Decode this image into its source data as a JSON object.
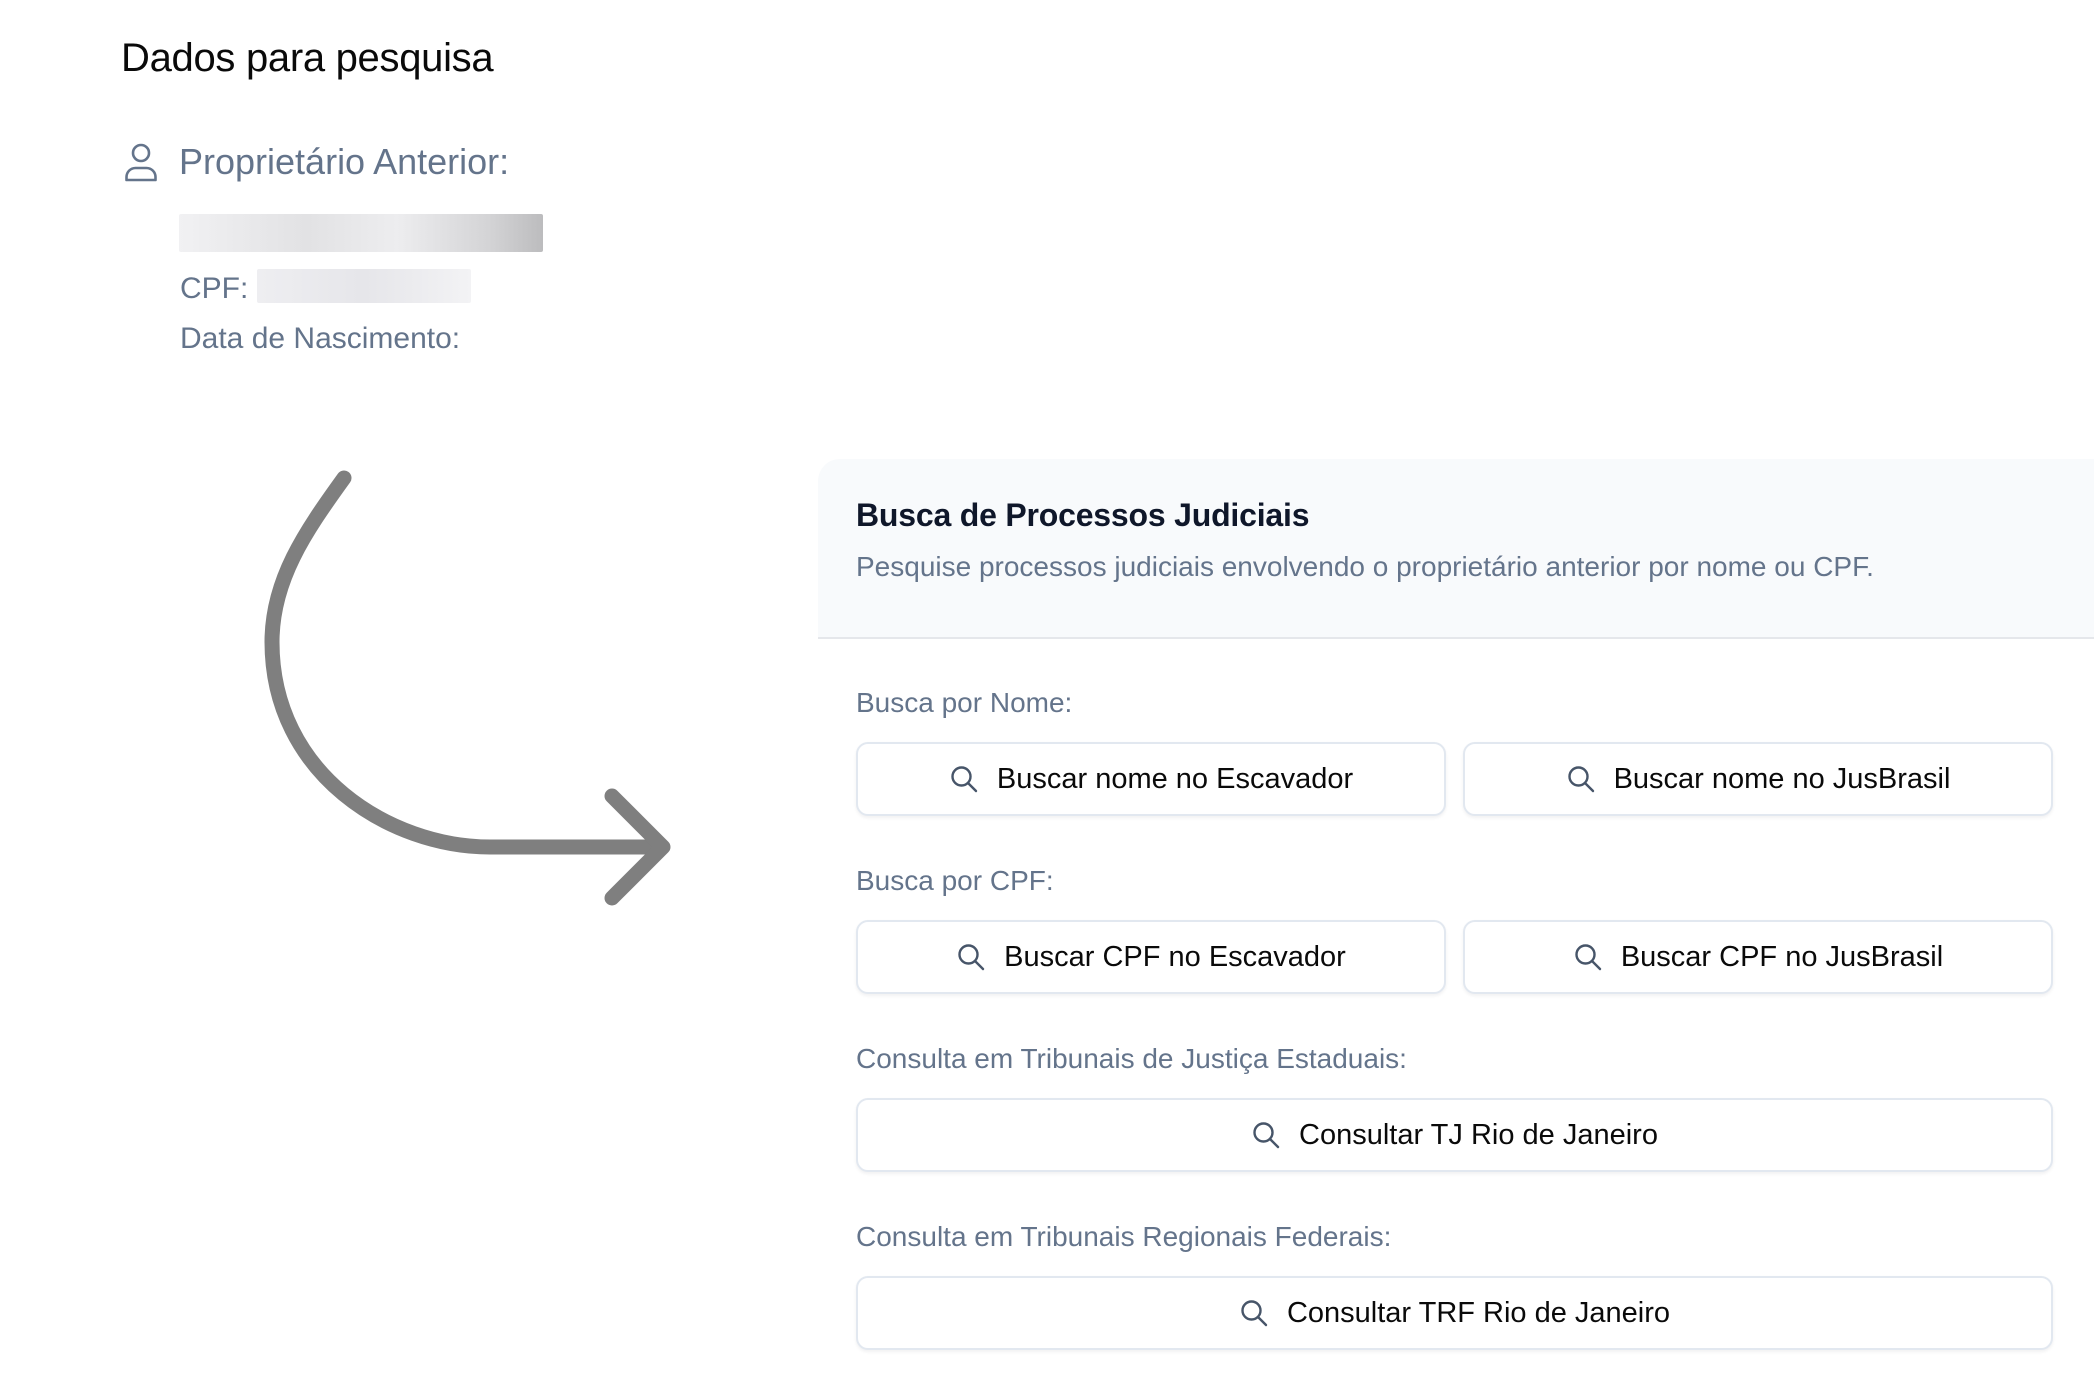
{
  "page": {
    "title": "Dados para pesquisa"
  },
  "owner": {
    "title": "Proprietário Anterior:",
    "cpf_label": "CPF:",
    "birth_label": "Data de Nascimento:"
  },
  "card": {
    "title": "Busca de Processos Judiciais",
    "description": "Pesquise processos judiciais envolvendo o proprietário anterior por nome ou CPF.",
    "sections": {
      "name": {
        "label": "Busca por Nome:",
        "buttons": [
          "Buscar nome no Escavador",
          "Buscar nome no JusBrasil"
        ]
      },
      "cpf": {
        "label": "Busca por CPF:",
        "buttons": [
          "Buscar CPF no Escavador",
          "Buscar CPF no JusBrasil"
        ]
      },
      "state_courts": {
        "label": "Consulta em Tribunais de Justiça Estaduais:",
        "buttons": [
          "Consultar TJ Rio de Janeiro"
        ]
      },
      "federal_courts": {
        "label": "Consulta em Tribunais Regionais Federais:",
        "buttons": [
          "Consultar TRF Rio de Janeiro"
        ]
      }
    }
  },
  "icons": {
    "owner": "user-icon",
    "search": "search-icon",
    "arrow": "curved-arrow-icon"
  },
  "colors": {
    "muted_text": "#64748b",
    "heading": "#0f172a",
    "border": "#e2e8f0",
    "header_bg": "#f8fafc",
    "arrow": "#7f7f7f"
  }
}
